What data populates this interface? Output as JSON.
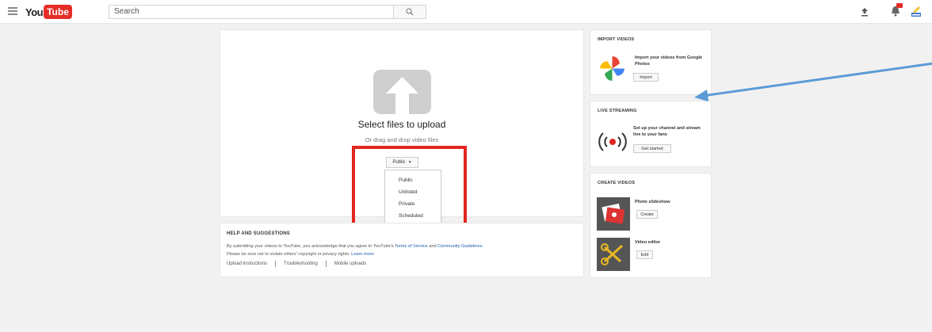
{
  "header": {
    "logo_you": "You",
    "logo_tube": "Tube",
    "search_value": "Search"
  },
  "upload": {
    "title": "Select files to upload",
    "subtitle": "Or drag and drop video files",
    "privacy_selected": "Public",
    "privacy_options": [
      "Public",
      "Unlisted",
      "Private",
      "Scheduled"
    ]
  },
  "help": {
    "title": "HELP AND SUGGESTIONS",
    "text_1": "By submitting your videos to YouTube, you acknowledge that you agree to YouTube's ",
    "link_tos": "Terms of Service",
    "text_2": " and ",
    "link_guidelines": "Community Guidelines",
    "text_3": ".",
    "text_4": "Please be sure not to violate others' copyright or privacy rights. ",
    "link_learn": "Learn more",
    "links": [
      "Upload instructions",
      "Troubleshooting",
      "Mobile uploads"
    ]
  },
  "import_videos": {
    "title": "IMPORT VIDEOS",
    "text": "Import your videos from Google Photos",
    "button": "Import"
  },
  "live_streaming": {
    "title": "LIVE STREAMING",
    "text": "Set up your channel and stream live to your fans",
    "button": "Get started"
  },
  "create_videos": {
    "title": "CREATE VIDEOS",
    "slideshow_label": "Photo slideshow",
    "slideshow_button": "Create",
    "editor_label": "Video editor",
    "editor_button": "Edit"
  },
  "colors": {
    "highlight": "#e2261f",
    "annotation_arrow": "#5b9bd5",
    "brand_red": "#e52d27"
  }
}
